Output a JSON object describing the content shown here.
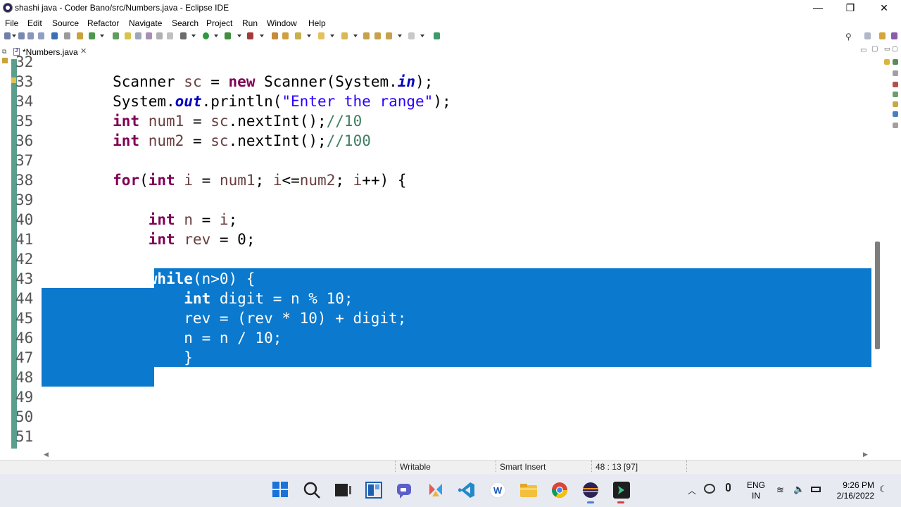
{
  "window": {
    "title": "shashi java - Coder Bano/src/Numbers.java - Eclipse IDE",
    "minimize": "—",
    "maximize": "❐",
    "close": "✕"
  },
  "menu": [
    "File",
    "Edit",
    "Source",
    "Refactor",
    "Navigate",
    "Search",
    "Project",
    "Run",
    "Window",
    "Help"
  ],
  "editor_tab": {
    "label": "*Numbers.java",
    "close": "✕"
  },
  "code_lines": [
    {
      "num": "32",
      "segments": [
        {
          "t": "",
          "c": ""
        }
      ]
    },
    {
      "num": "33",
      "segments": [
        {
          "t": "        Scanner ",
          "c": ""
        },
        {
          "t": "sc",
          "c": "var"
        },
        {
          "t": " = ",
          "c": ""
        },
        {
          "t": "new",
          "c": "kw"
        },
        {
          "t": " Scanner(System.",
          "c": ""
        },
        {
          "t": "in",
          "c": "fld"
        },
        {
          "t": ");",
          "c": ""
        }
      ]
    },
    {
      "num": "34",
      "segments": [
        {
          "t": "        System.",
          "c": ""
        },
        {
          "t": "out",
          "c": "fld"
        },
        {
          "t": ".println(",
          "c": ""
        },
        {
          "t": "\"Enter the range\"",
          "c": "str"
        },
        {
          "t": ");",
          "c": ""
        }
      ]
    },
    {
      "num": "35",
      "segments": [
        {
          "t": "        ",
          "c": ""
        },
        {
          "t": "int",
          "c": "kw"
        },
        {
          "t": " ",
          "c": ""
        },
        {
          "t": "num1",
          "c": "var"
        },
        {
          "t": " = ",
          "c": ""
        },
        {
          "t": "sc",
          "c": "var"
        },
        {
          "t": ".nextInt();",
          "c": ""
        },
        {
          "t": "//10",
          "c": "cmt"
        }
      ]
    },
    {
      "num": "36",
      "segments": [
        {
          "t": "        ",
          "c": ""
        },
        {
          "t": "int",
          "c": "kw"
        },
        {
          "t": " ",
          "c": ""
        },
        {
          "t": "num2",
          "c": "var"
        },
        {
          "t": " = ",
          "c": ""
        },
        {
          "t": "sc",
          "c": "var"
        },
        {
          "t": ".nextInt();",
          "c": ""
        },
        {
          "t": "//100",
          "c": "cmt"
        }
      ]
    },
    {
      "num": "37",
      "segments": [
        {
          "t": "",
          "c": ""
        }
      ]
    },
    {
      "num": "38",
      "segments": [
        {
          "t": "        ",
          "c": ""
        },
        {
          "t": "for",
          "c": "kw"
        },
        {
          "t": "(",
          "c": ""
        },
        {
          "t": "int",
          "c": "kw"
        },
        {
          "t": " ",
          "c": ""
        },
        {
          "t": "i",
          "c": "var"
        },
        {
          "t": " = ",
          "c": ""
        },
        {
          "t": "num1",
          "c": "var"
        },
        {
          "t": "; ",
          "c": ""
        },
        {
          "t": "i",
          "c": "var"
        },
        {
          "t": "<=",
          "c": ""
        },
        {
          "t": "num2",
          "c": "var"
        },
        {
          "t": "; ",
          "c": ""
        },
        {
          "t": "i",
          "c": "var"
        },
        {
          "t": "++) {",
          "c": ""
        }
      ]
    },
    {
      "num": "39",
      "segments": [
        {
          "t": "",
          "c": ""
        }
      ]
    },
    {
      "num": "40",
      "segments": [
        {
          "t": "            ",
          "c": ""
        },
        {
          "t": "int",
          "c": "kw"
        },
        {
          "t": " ",
          "c": ""
        },
        {
          "t": "n",
          "c": "var"
        },
        {
          "t": " = ",
          "c": ""
        },
        {
          "t": "i",
          "c": "var"
        },
        {
          "t": ";",
          "c": ""
        }
      ]
    },
    {
      "num": "41",
      "segments": [
        {
          "t": "            ",
          "c": ""
        },
        {
          "t": "int",
          "c": "kw"
        },
        {
          "t": " ",
          "c": ""
        },
        {
          "t": "rev",
          "c": "var"
        },
        {
          "t": " = 0;",
          "c": ""
        }
      ]
    },
    {
      "num": "42",
      "segments": [
        {
          "t": "",
          "c": ""
        }
      ]
    },
    {
      "num": "43",
      "segments": [
        {
          "t": "            ",
          "c": ""
        },
        {
          "t": "while",
          "c": "kw"
        },
        {
          "t": "(n>0) {",
          "c": ""
        }
      ]
    },
    {
      "num": "44",
      "segments": [
        {
          "t": "                ",
          "c": ""
        },
        {
          "t": "int",
          "c": "kw"
        },
        {
          "t": " digit = n % 10;",
          "c": ""
        }
      ]
    },
    {
      "num": "45",
      "segments": [
        {
          "t": "                rev = (rev * 10) + digit;",
          "c": ""
        }
      ]
    },
    {
      "num": "46",
      "segments": [
        {
          "t": "                n = n / 10;",
          "c": ""
        }
      ]
    },
    {
      "num": "47",
      "segments": [
        {
          "t": "                }",
          "c": ""
        }
      ]
    },
    {
      "num": "48",
      "segments": [
        {
          "t": "",
          "c": ""
        }
      ]
    },
    {
      "num": "49",
      "segments": [
        {
          "t": "",
          "c": ""
        }
      ]
    },
    {
      "num": "50",
      "segments": [
        {
          "t": "",
          "c": ""
        }
      ]
    },
    {
      "num": "51",
      "segments": [
        {
          "t": "",
          "c": ""
        }
      ]
    }
  ],
  "selection": {
    "from_line": "43",
    "to_line": "48",
    "color": "#0a79ce"
  },
  "status": {
    "mode": "Writable",
    "insert": "Smart Insert",
    "position": "48 : 13 [97]"
  },
  "taskbar": {
    "apps": [
      "windows-start-icon",
      "search-icon",
      "task-view-icon",
      "widgets-icon",
      "chat-icon",
      "snip-icon",
      "vscode-icon",
      "word-icon",
      "file-explorer-icon",
      "chrome-icon",
      "eclipse-icon",
      "terminal-icon"
    ],
    "lang_line1": "ENG",
    "lang_line2": "IN",
    "time": "9:26 PM",
    "date": "2/16/2022"
  },
  "colors": {
    "keyword": "#7f0055",
    "string": "#2a00ff",
    "field": "#0000c0",
    "local_var": "#6a3e3e",
    "comment": "#3f7f5f",
    "ruler": "#5a9e8c"
  }
}
